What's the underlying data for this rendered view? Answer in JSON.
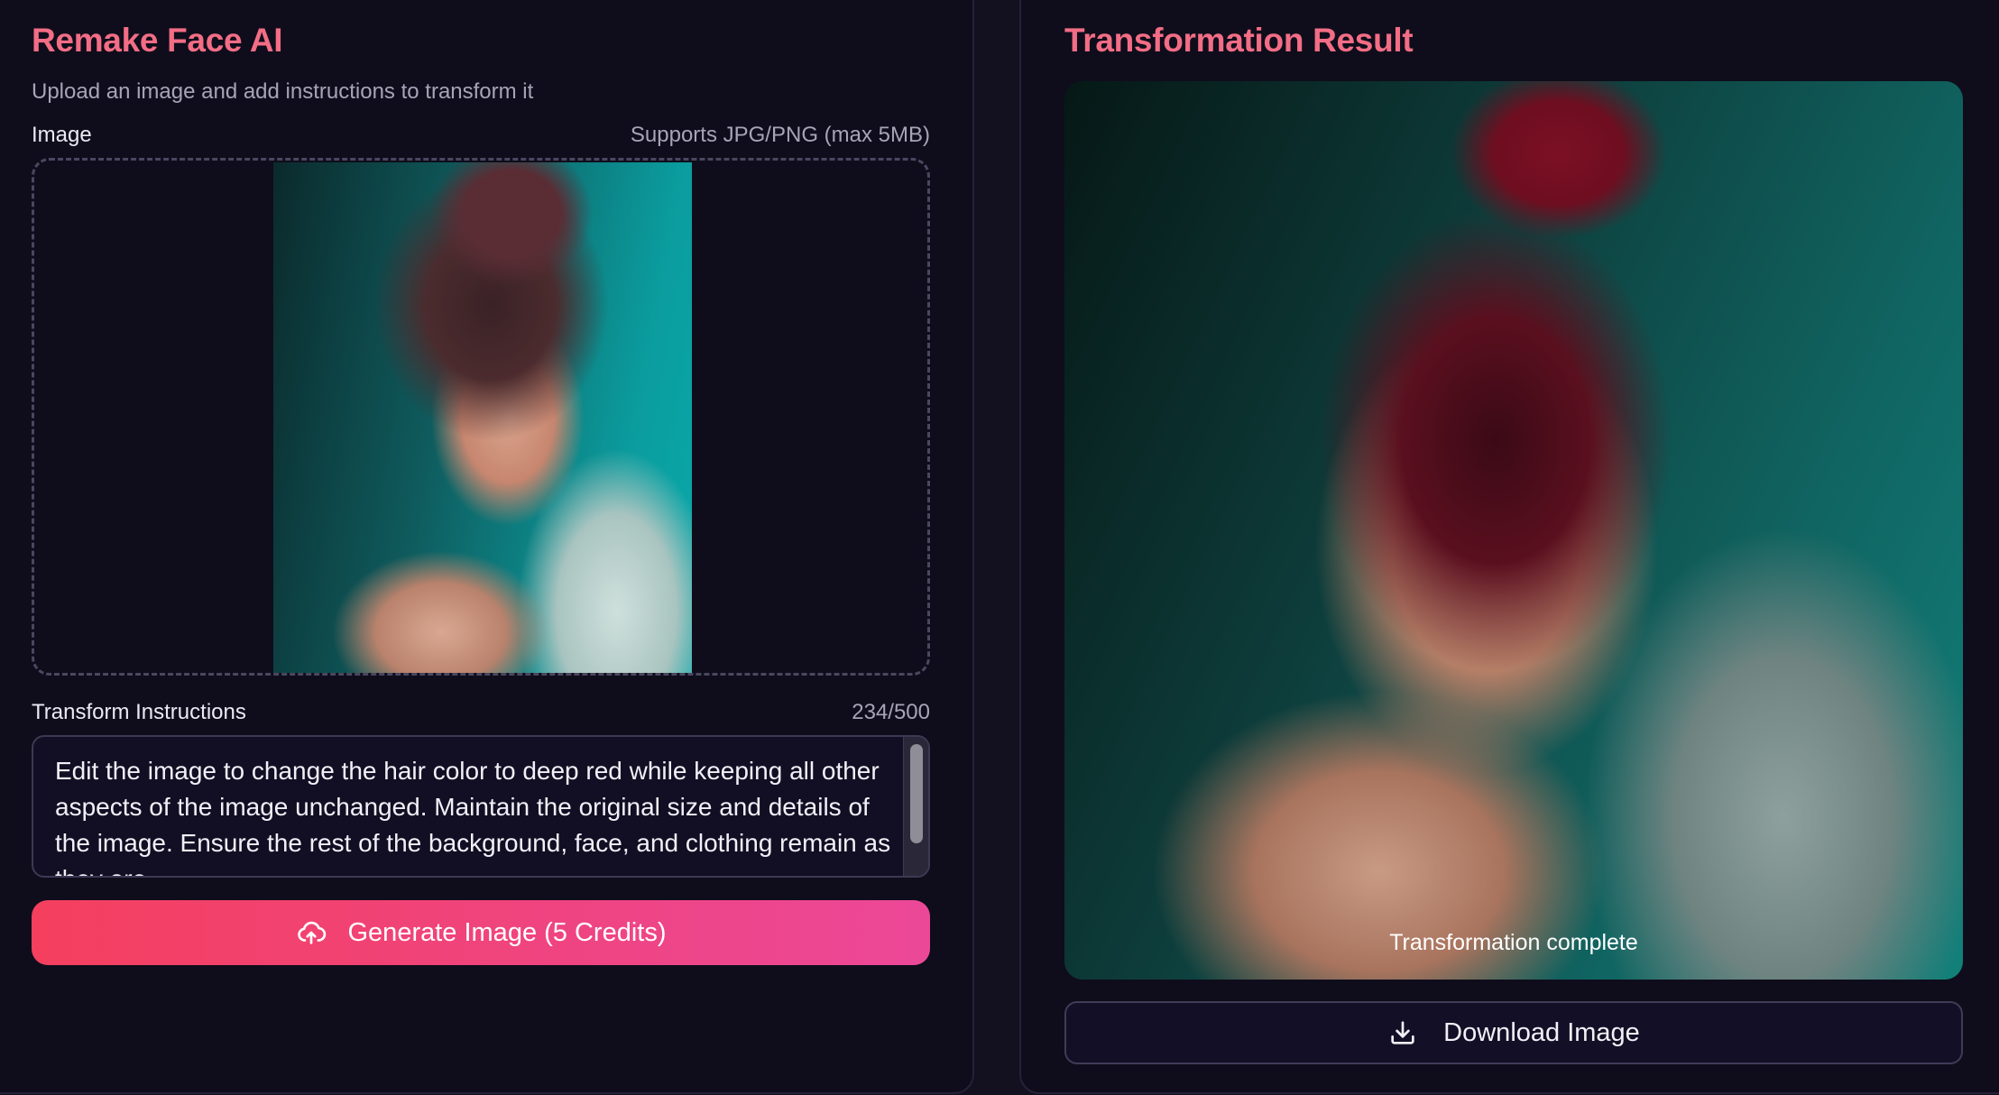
{
  "left": {
    "title": "Remake Face AI",
    "subtitle": "Upload an image and add instructions to transform it",
    "image_label": "Image",
    "image_hint": "Supports JPG/PNG (max 5MB)",
    "instructions_label": "Transform Instructions",
    "char_count": "234/500",
    "instructions_text": "Edit the image to change the hair color to deep red while keeping all other aspects of the image unchanged. Maintain the original size and details of the image. Ensure the rest of the background, face, and clothing remain as they are.",
    "generate_label": "Generate Image (5 Credits)",
    "generate_icon": "cloud-upload-icon"
  },
  "right": {
    "title": "Transformation Result",
    "result_caption": "Transformation complete",
    "download_label": "Download Image",
    "download_icon": "download-icon"
  },
  "colors": {
    "accent_title": "#f26d85",
    "button_gradient_start": "#f43f5e",
    "button_gradient_end": "#ec4899",
    "background": "#0f0d1b"
  }
}
